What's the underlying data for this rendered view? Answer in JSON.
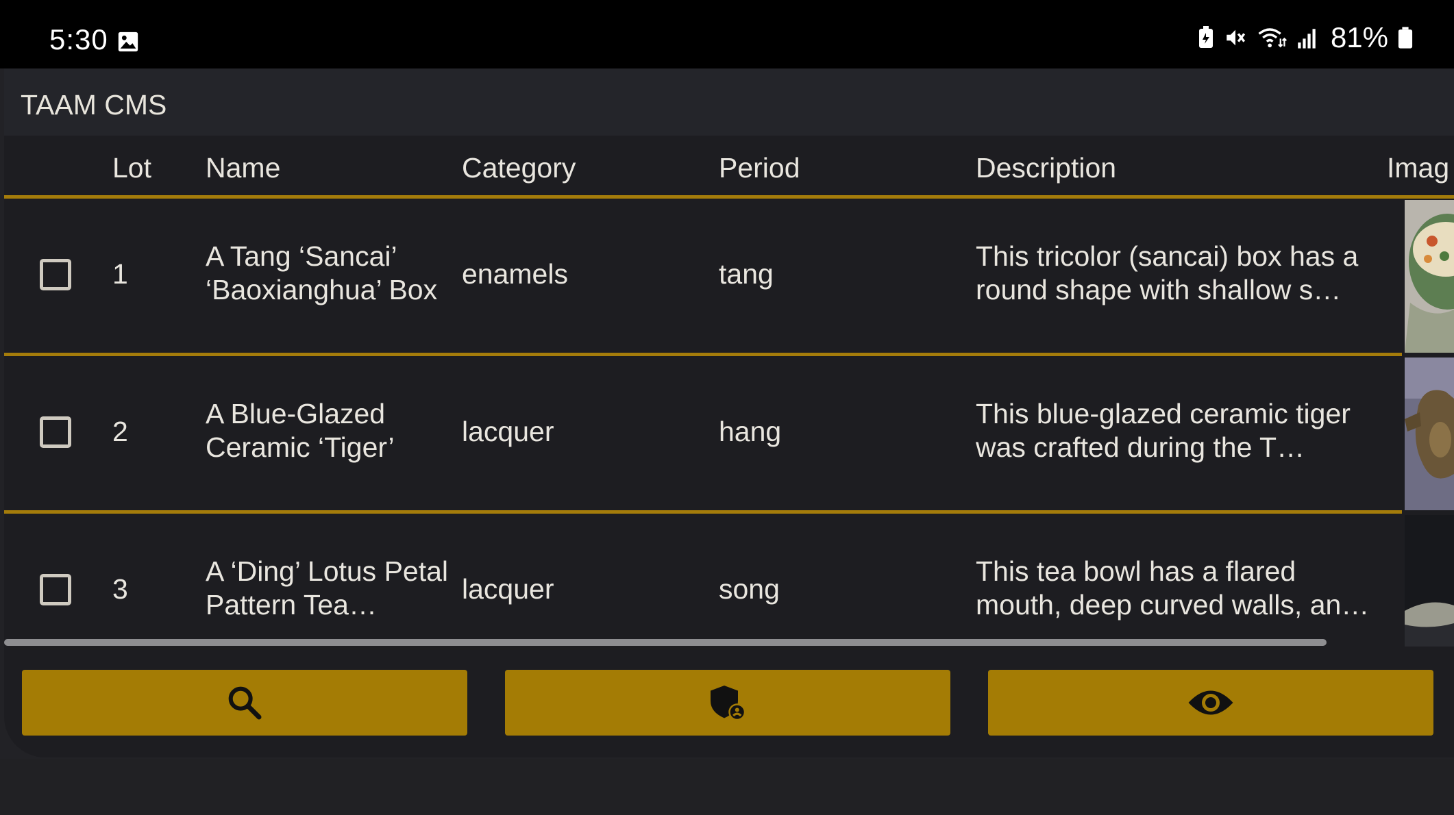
{
  "status_bar": {
    "time": "5:30",
    "battery": "81%",
    "icons": [
      "image-icon",
      "battery-saver-icon",
      "mute-icon",
      "wifi-icon",
      "signal-icon",
      "battery-icon"
    ]
  },
  "app": {
    "title": "TAAM CMS"
  },
  "table": {
    "columns": {
      "lot": "Lot",
      "name": "Name",
      "category": "Category",
      "period": "Period",
      "description": "Description",
      "image": "Imag"
    },
    "rows": [
      {
        "lot": "1",
        "name": "A Tang ‘Sancai’ ‘Baoxianghua’ Box",
        "category": "enamels",
        "period": "tang",
        "description": "This tricolor (sancai) box has a round shape with shallow s…"
      },
      {
        "lot": "2",
        "name": "A Blue-Glazed Ceramic ‘Tiger’",
        "category": "lacquer",
        "period": "hang",
        "description": "This blue-glazed ceramic tiger was crafted during the T…"
      },
      {
        "lot": "3",
        "name": "A ‘Ding’ Lotus Petal Pattern Tea…",
        "category": "lacquer",
        "period": "song",
        "description": "This tea bowl has a flared mouth, deep curved walls, an…"
      }
    ]
  },
  "actions": {
    "buttons": [
      "search-icon",
      "admin-shield-icon",
      "eye-icon"
    ]
  },
  "colors": {
    "accent": "#a47c05",
    "background": "#1d1d21",
    "appbar": "#24252a"
  }
}
